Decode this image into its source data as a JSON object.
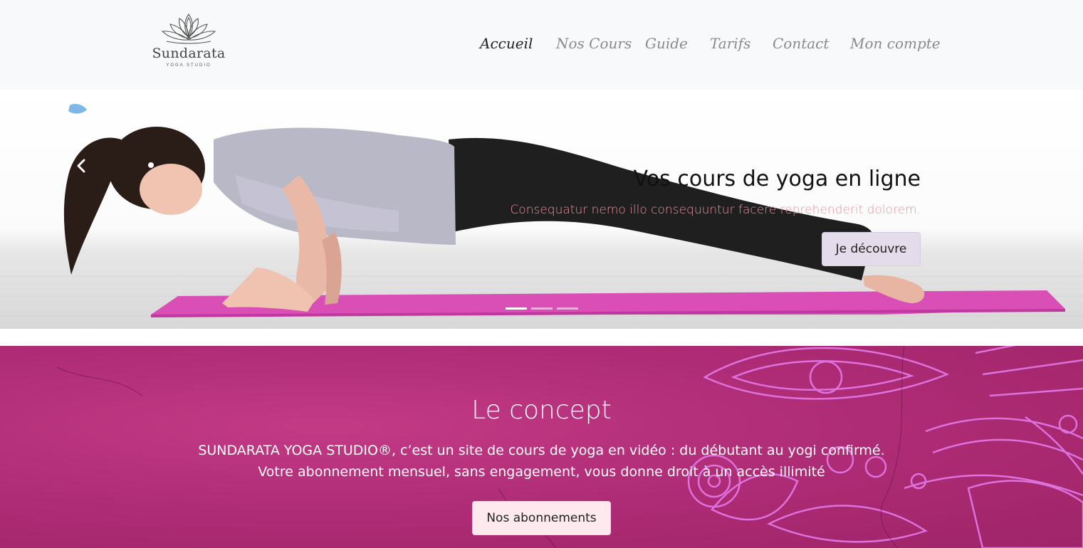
{
  "brand": {
    "name": "Sundarata",
    "tagline": "YOGA STUDIO",
    "logo_icon": "lotus-icon"
  },
  "nav": {
    "items": [
      {
        "label": "Accueil",
        "active": true
      },
      {
        "label": "Nos Cours",
        "active": false
      },
      {
        "label": "Guide",
        "active": false
      },
      {
        "label": "Tarifs",
        "active": false
      },
      {
        "label": "Contact",
        "active": false
      },
      {
        "label": "Mon compte",
        "active": false
      }
    ]
  },
  "carousel": {
    "title": "Vos cours de yoga en ligne",
    "subtitle": "Consequatur nemo illo consequuntur facere reprehenderit dolorem.",
    "button_label": "Je découvre",
    "prev_icon": "chevron-left-icon",
    "slide_count": 3,
    "active_slide": 1
  },
  "concept": {
    "title": "Le concept",
    "line1": "SUNDARATA YOGA STUDIO®, c’est un site de cours de yoga en vidéo : du débutant au yogi confirmé.",
    "line2": "Votre abonnement mensuel, sans engagement, vous donne droit à un accès illimité",
    "button_label": "Nos abonnements"
  },
  "colors": {
    "header_bg": "#f8f9fa",
    "accent_pink": "#b02d77",
    "subtitle_pink": "#e8939e",
    "hero_button_bg": "#e4dcea",
    "concept_button_bg": "#fde9ee",
    "mat": "#d94fb6"
  }
}
